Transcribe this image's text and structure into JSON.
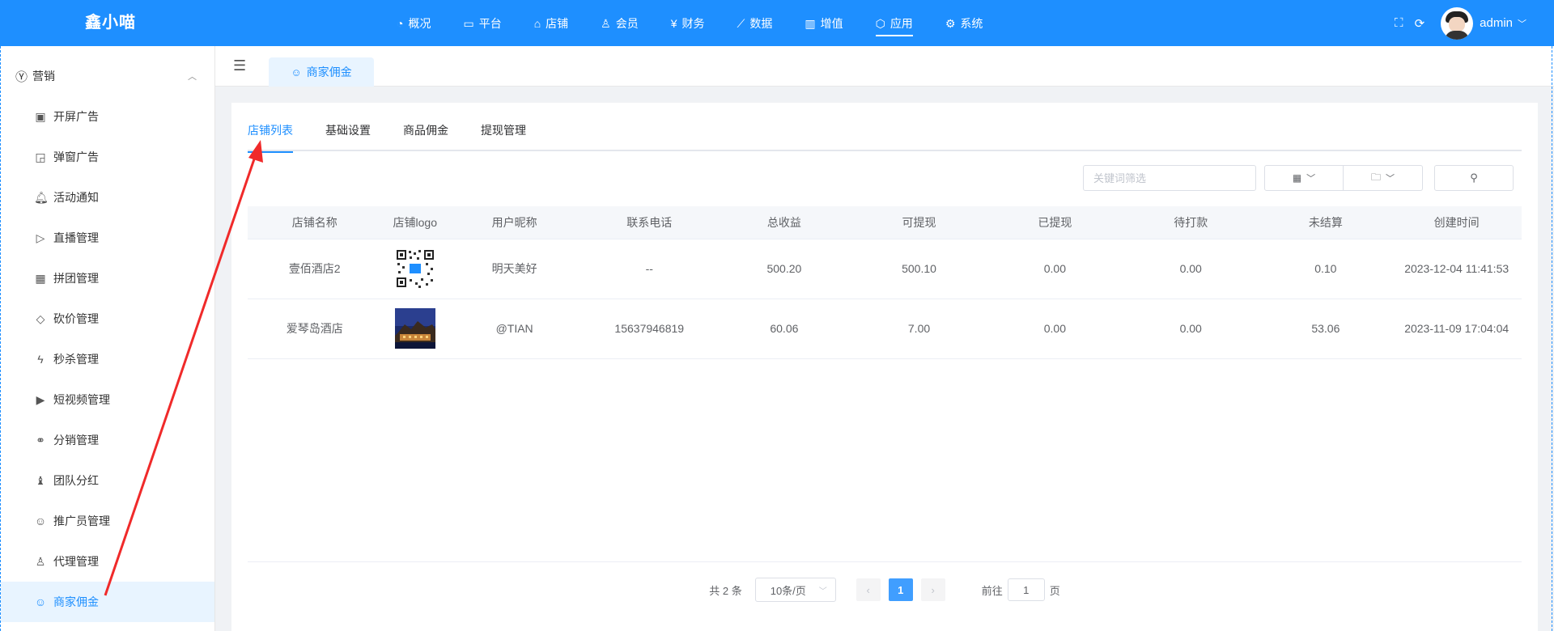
{
  "brand": "鑫小喵",
  "topnav": [
    {
      "icon": "dashboard-icon",
      "glyph": "◔",
      "label": "概况"
    },
    {
      "icon": "platform-icon",
      "glyph": "▭",
      "label": "平台"
    },
    {
      "icon": "store-icon",
      "glyph": "⌂",
      "label": "店铺"
    },
    {
      "icon": "member-icon",
      "glyph": "♙",
      "label": "会员"
    },
    {
      "icon": "finance-icon",
      "glyph": "¥",
      "label": "财务"
    },
    {
      "icon": "data-icon",
      "glyph": "⟋",
      "label": "数据"
    },
    {
      "icon": "value-added-icon",
      "glyph": "▥",
      "label": "增值"
    },
    {
      "icon": "app-icon",
      "glyph": "⬡",
      "label": "应用"
    },
    {
      "icon": "system-icon",
      "glyph": "⚙",
      "label": "系统"
    }
  ],
  "user": {
    "name": "admin"
  },
  "sidebar": {
    "group": {
      "icon": "yen-circle-icon",
      "glyph": "¥",
      "label": "营销"
    },
    "items": [
      {
        "icon": "ad-icon",
        "glyph": "▣",
        "label": "开屏广告"
      },
      {
        "icon": "popup-icon",
        "glyph": "◲",
        "label": "弹窗广告"
      },
      {
        "icon": "bell-icon",
        "glyph": "♫",
        "label": "活动通知"
      },
      {
        "icon": "live-icon",
        "glyph": "▷",
        "label": "直播管理"
      },
      {
        "icon": "group-buy-icon",
        "glyph": "▦",
        "label": "拼团管理"
      },
      {
        "icon": "bargain-icon",
        "glyph": "◇",
        "label": "砍价管理"
      },
      {
        "icon": "flash-sale-icon",
        "glyph": "ϟ",
        "label": "秒杀管理"
      },
      {
        "icon": "video-icon",
        "glyph": "▶",
        "label": "短视频管理"
      },
      {
        "icon": "distribution-icon",
        "glyph": "⚭",
        "label": "分销管理"
      },
      {
        "icon": "team-bonus-icon",
        "glyph": "♝",
        "label": "团队分红"
      },
      {
        "icon": "promoter-icon",
        "glyph": "☺",
        "label": "推广员管理"
      },
      {
        "icon": "agent-icon",
        "glyph": "♙",
        "label": "代理管理"
      },
      {
        "icon": "merchant-commission-icon",
        "glyph": "☺",
        "label": "商家佣金"
      }
    ]
  },
  "page_tab": {
    "icon": "merchant-commission-icon",
    "glyph": "☺",
    "label": "商家佣金"
  },
  "subtabs": [
    "店铺列表",
    "基础设置",
    "商品佣金",
    "提现管理"
  ],
  "toolbar": {
    "search_placeholder": "关键词筛选"
  },
  "table": {
    "headers": [
      "店铺名称",
      "店铺logo",
      "用户昵称",
      "联系电话",
      "总收益",
      "可提现",
      "已提现",
      "待打款",
      "未结算",
      "创建时间"
    ],
    "rows": [
      {
        "name": "壹佰酒店2",
        "nickname": "明天美好",
        "phone": "--",
        "total": "500.20",
        "withdrawable": "500.10",
        "withdrawn": "0.00",
        "pending": "0.00",
        "unsettled": "0.10",
        "created": "2023-12-04 11:41:53"
      },
      {
        "name": "爱琴岛酒店",
        "nickname": "@TIAN",
        "phone": "15637946819",
        "total": "60.06",
        "withdrawable": "7.00",
        "withdrawn": "0.00",
        "pending": "0.00",
        "unsettled": "53.06",
        "created": "2023-11-09 17:04:04"
      }
    ]
  },
  "pagination": {
    "total": "共 2 条",
    "page_size": "10条/页",
    "current": "1",
    "goto_prefix": "前往",
    "goto_value": "1",
    "goto_suffix": "页"
  },
  "colors": {
    "primary": "#1e8fff",
    "annotation_arrow": "#f02a2a"
  }
}
